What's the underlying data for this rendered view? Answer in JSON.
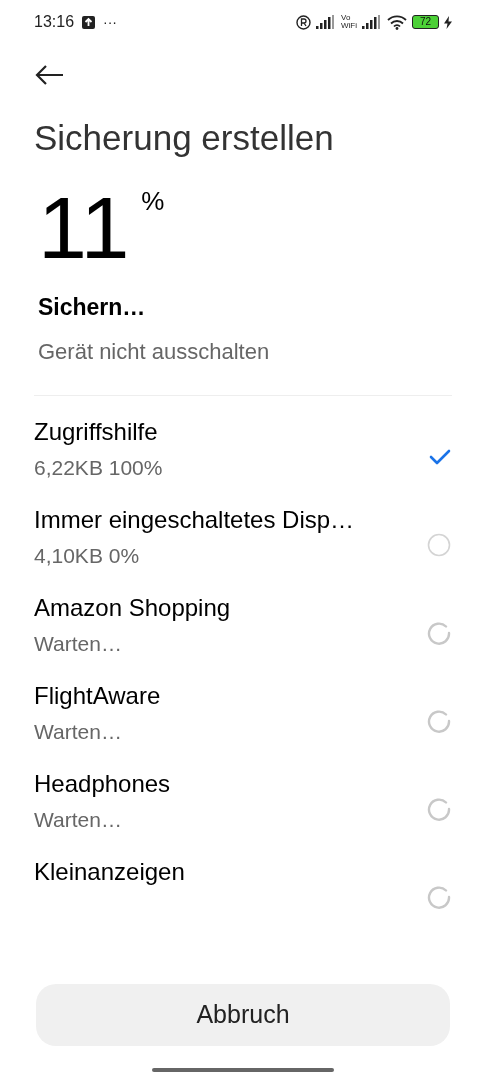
{
  "status_bar": {
    "time": "13:16",
    "dots": "···",
    "vowifi_top": "Vo",
    "vowifi_bottom": "WiFi",
    "battery": "72",
    "charging": true
  },
  "header": {
    "title": "Sicherung erstellen"
  },
  "progress": {
    "value": "11",
    "unit": "%",
    "state": "Sichern…",
    "hint": "Gerät nicht ausschalten"
  },
  "items": [
    {
      "name": "Zugriffshilfe",
      "status": "6,22KB 100%",
      "kind": "done"
    },
    {
      "name": "Immer eingeschaltetes Disp…",
      "status": "4,10KB 0%",
      "kind": "pending"
    },
    {
      "name": "Amazon Shopping",
      "status": "Warten…",
      "kind": "waiting"
    },
    {
      "name": "FlightAware",
      "status": "Warten…",
      "kind": "waiting"
    },
    {
      "name": "Headphones",
      "status": "Warten…",
      "kind": "waiting"
    },
    {
      "name": "Kleinanzeigen",
      "kind": "waiting"
    }
  ],
  "cancel_button": "Abbruch"
}
